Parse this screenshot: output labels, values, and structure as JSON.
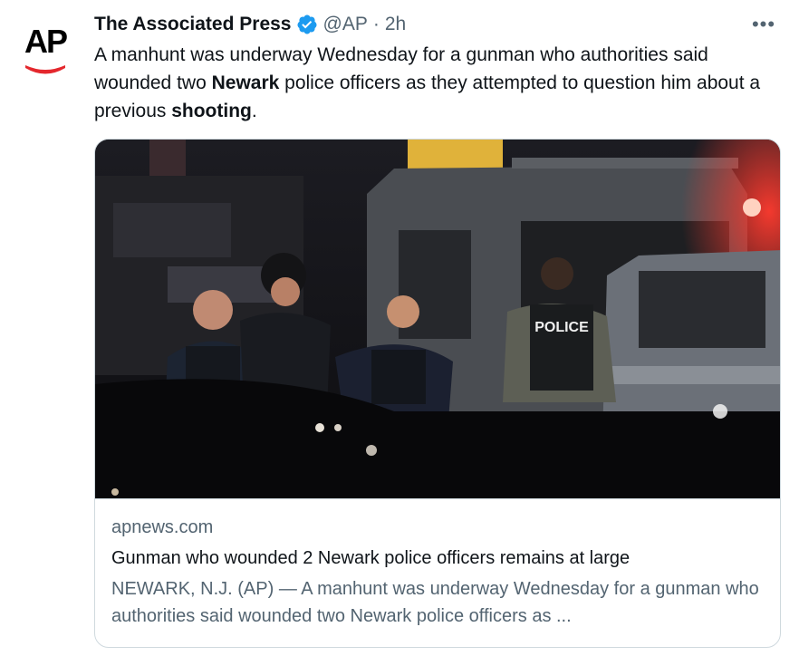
{
  "tweet": {
    "display_name": "The Associated Press",
    "handle": "@AP",
    "separator": "·",
    "time": "2h",
    "avatar_text": "AP",
    "text_parts": [
      "A manhunt was underway Wednesday for a gunman who authorities said wounded two ",
      "Newark",
      " police officers as they attempted to question him about a previous ",
      "shooting",
      "."
    ],
    "more_label": "•••"
  },
  "card": {
    "domain": "apnews.com",
    "title": "Gunman who wounded 2 Newark police officers remains at large",
    "description": "NEWARK, N.J. (AP) — A manhunt was underway Wednesday for a gunman who authorities said wounded two Newark police officers as ...",
    "image_vest_text": "POLICE"
  },
  "colors": {
    "verified": "#1d9bf0",
    "secondary_text": "#536471",
    "primary_text": "#0f1419",
    "border": "#cfd9de",
    "ap_red": "#e4272d"
  }
}
